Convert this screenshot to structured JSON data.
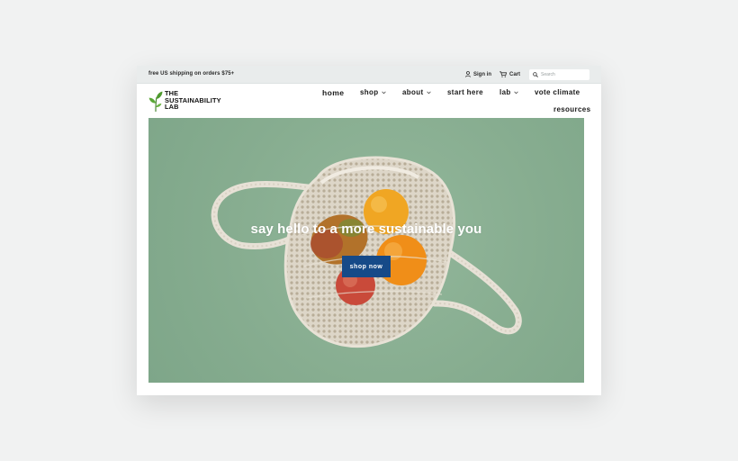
{
  "topbar": {
    "shipping_text": "free US shipping on orders $75+",
    "signin_label": "Sign in",
    "cart_label": "Cart",
    "search_placeholder": "Search"
  },
  "brand": {
    "line1": "THE",
    "line2": "SUSTAINABILITY",
    "line3": "LAB"
  },
  "nav": {
    "home": "home",
    "shop": "shop",
    "about": "about",
    "start_here": "start here",
    "lab": "lab",
    "vote_climate": "vote climate",
    "resources": "resources"
  },
  "hero": {
    "headline": "say hello to a more sustainable you",
    "button_label": "shop now"
  },
  "colors": {
    "hero_bg": "#87ad90",
    "button_bg": "#164a88",
    "page_bg": "#f1f2f2",
    "logo_leaf": "#4e9a2e"
  },
  "icons": {
    "signin": "user-icon",
    "cart": "cart-icon",
    "search": "search-icon",
    "dropdown": "chevron-down-icon",
    "logo": "leaf-icon"
  }
}
